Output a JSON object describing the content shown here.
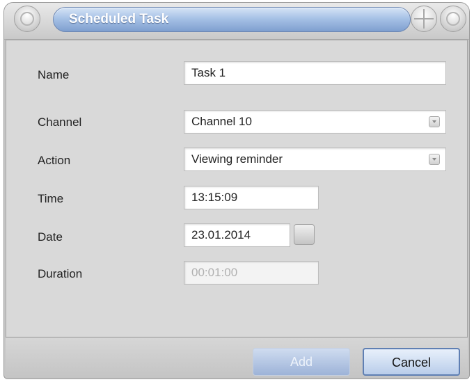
{
  "window": {
    "title": "Scheduled Task"
  },
  "form": {
    "name_label": "Name",
    "name_value": "Task 1",
    "channel_label": "Channel",
    "channel_value": "Channel 10",
    "action_label": "Action",
    "action_value": "Viewing reminder",
    "time_label": "Time",
    "time_value": "13:15:09",
    "date_label": "Date",
    "date_value": "23.01.2014",
    "duration_label": "Duration",
    "duration_value": "00:01:00"
  },
  "buttons": {
    "add": "Add",
    "cancel": "Cancel"
  },
  "colors": {
    "accent": "#8fabd6",
    "window_bg": "#d9d9d9"
  }
}
